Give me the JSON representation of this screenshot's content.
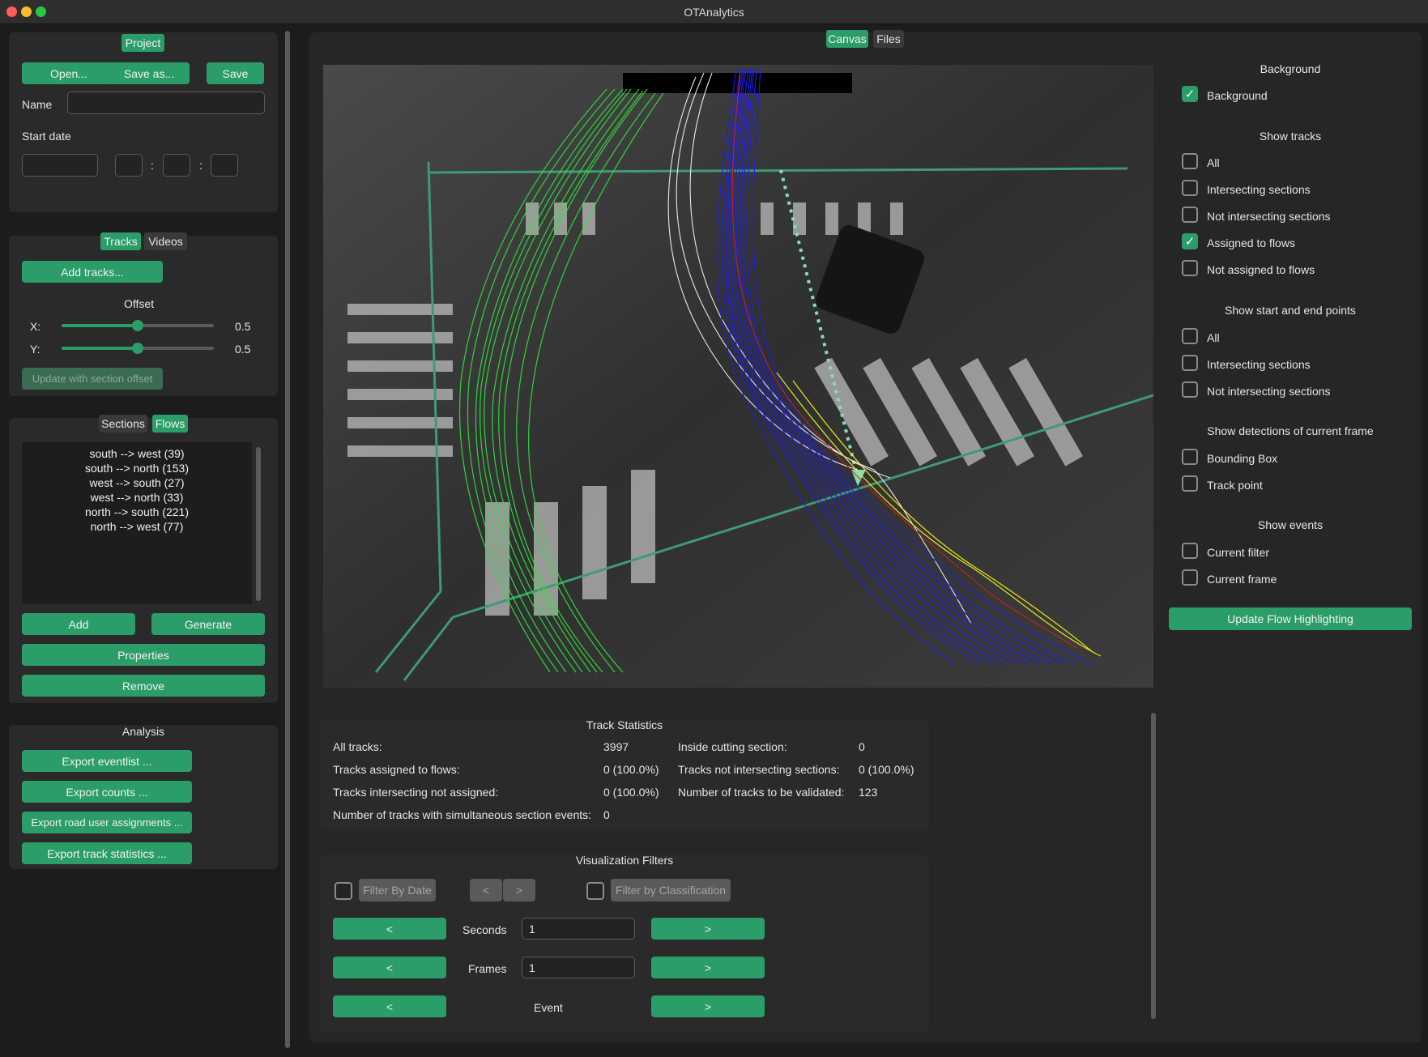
{
  "window": {
    "title": "OTAnalytics",
    "traffic_lights": {
      "close": "#ff5f57",
      "minimize": "#febc2e",
      "maximize": "#28c840"
    }
  },
  "colors": {
    "accent": "#2a9d68",
    "panel": "#2a2a2a",
    "background": "#1c1c1c"
  },
  "project": {
    "tab_label": "Project",
    "open_label": "Open...",
    "save_as_label": "Save as...",
    "save_label": "Save",
    "name_label": "Name",
    "name_value": "",
    "start_date_label": "Start date",
    "date_value": "",
    "hour_value": "",
    "minute_value": "",
    "second_value": "",
    "time_sep": ":"
  },
  "tracks_panel": {
    "tabs": [
      "Tracks",
      "Videos"
    ],
    "add_tracks_label": "Add tracks...",
    "offset_label": "Offset",
    "x_label": "X:",
    "x_value": "0.5",
    "y_label": "Y:",
    "y_value": "0.5",
    "update_offset_label": "Update with section offset"
  },
  "flows_panel": {
    "tabs": [
      "Sections",
      "Flows"
    ],
    "flows": [
      "south --> west (39)",
      "south --> north (153)",
      "west --> south (27)",
      "west --> north (33)",
      "north --> south (221)",
      "north --> west (77)"
    ],
    "add_label": "Add",
    "generate_label": "Generate",
    "properties_label": "Properties",
    "remove_label": "Remove"
  },
  "analysis": {
    "title": "Analysis",
    "export_eventlist": "Export eventlist ...",
    "export_counts": "Export counts ...",
    "export_road_user": "Export road user assignments ...",
    "export_track_statistics": "Export track statistics ..."
  },
  "main_tabs": [
    "Canvas",
    "Files"
  ],
  "canvas_options": {
    "background_title": "Background",
    "background_label": "Background",
    "show_tracks_title": "Show tracks",
    "show_tracks": [
      {
        "label": "All",
        "checked": false
      },
      {
        "label": "Intersecting sections",
        "checked": false
      },
      {
        "label": "Not intersecting sections",
        "checked": false
      },
      {
        "label": "Assigned to flows",
        "checked": true
      },
      {
        "label": "Not assigned to flows",
        "checked": false
      }
    ],
    "start_end_title": "Show start and end points",
    "start_end": [
      "All",
      "Intersecting sections",
      "Not intersecting sections"
    ],
    "detections_title": "Show detections of current frame",
    "detections": [
      "Bounding Box",
      "Track point"
    ],
    "events_title": "Show events",
    "events": [
      "Current filter",
      "Current frame"
    ],
    "update_flow_label": "Update Flow Highlighting",
    "check_mark": "✓"
  },
  "track_statistics": {
    "title": "Track Statistics",
    "rows": [
      {
        "label": "All tracks:",
        "value": "3997"
      },
      {
        "label": "Tracks assigned to flows:",
        "value": "0 (100.0%)"
      },
      {
        "label": "Tracks intersecting not assigned:",
        "value": "0 (100.0%)"
      },
      {
        "label": "Number of tracks with simultaneous section events:",
        "value": "0"
      }
    ],
    "rows_right": [
      {
        "label": "Inside cutting section:",
        "value": "0"
      },
      {
        "label": "Tracks not intersecting sections:",
        "value": "0 (100.0%)"
      },
      {
        "label": "Number of tracks to be validated:",
        "value": "123"
      }
    ]
  },
  "visualization_filters": {
    "title": "Visualization Filters",
    "filter_by_date": "Filter By Date",
    "prev": "<",
    "next": ">",
    "filter_by_classification": "Filter by Classification",
    "seconds_label": "Seconds",
    "seconds_value": "1",
    "frames_label": "Frames",
    "frames_value": "1",
    "event_label": "Event"
  }
}
